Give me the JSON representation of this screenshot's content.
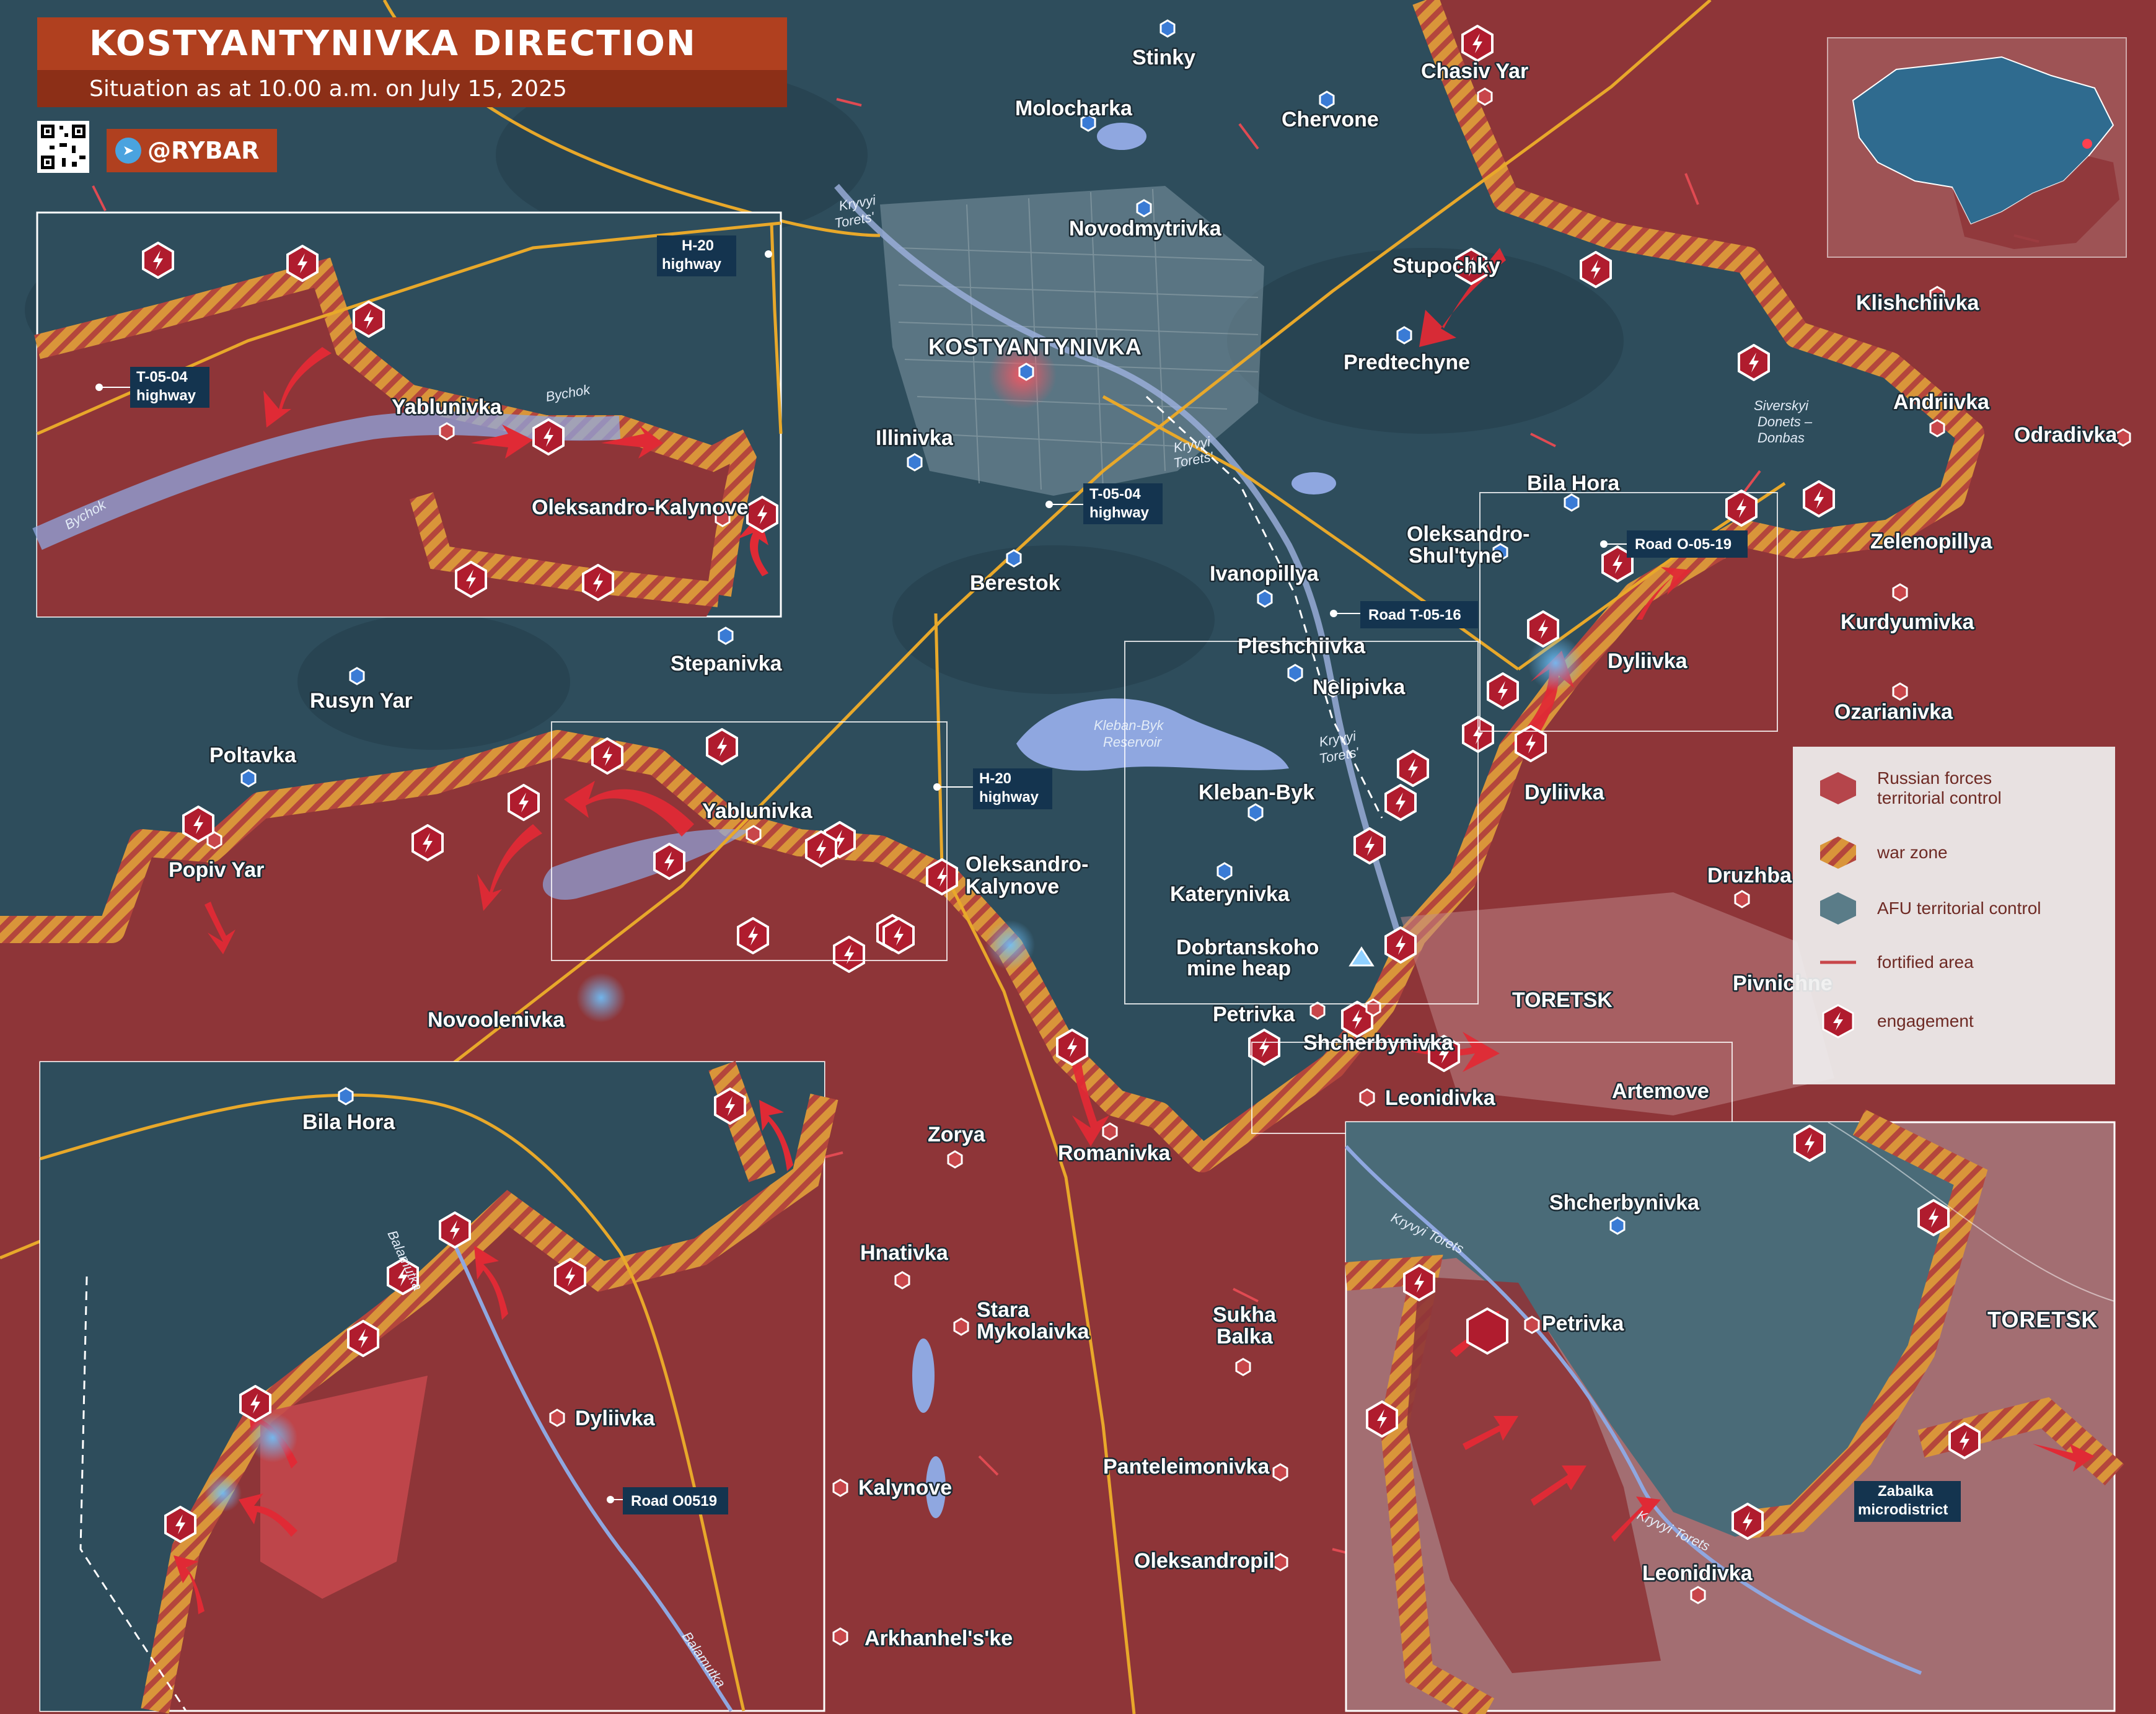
{
  "header": {
    "title": "KOSTYANTYNIVKA DIRECTION",
    "subtitle": "Situation as at 10.00 a.m. on July 15, 2025",
    "channel": "@RYBAR",
    "channel_icon": "telegram-icon",
    "qr_icon": "qr-code-icon"
  },
  "legend": {
    "items": [
      {
        "label": "Russian forces territorial control",
        "line1": "Russian forces",
        "line2": "territorial control",
        "icon": "russian-control-hexagon",
        "color": "#b5454b"
      },
      {
        "label": "war zone",
        "icon": "war-zone-hatch-hexagon",
        "color": "#d9953a"
      },
      {
        "label": "AFU territorial control",
        "icon": "afu-control-hexagon",
        "color": "#4a6b78"
      },
      {
        "label": "fortified area",
        "icon": "fortified-line",
        "color": "#c8464a"
      },
      {
        "label": "engagement",
        "icon": "engagement-lightning-icon",
        "color": "#b01c2e"
      }
    ]
  },
  "colors": {
    "russian": "#8e3538",
    "afu": "#2e4d5c",
    "warzone": "#d9953a",
    "road": "#e8a82a",
    "water": "#8fa7e0",
    "engagement": "#b01c2e"
  },
  "main_map": {
    "settlements": [
      {
        "name": "Stinky",
        "afu": true
      },
      {
        "name": "Chasiv Yar",
        "afu": false
      },
      {
        "name": "Molocharka",
        "afu": true
      },
      {
        "name": "Chervone",
        "afu": true
      },
      {
        "name": "Novodmytrivka",
        "afu": true
      },
      {
        "name": "Stupochky",
        "afu": false
      },
      {
        "name": "Klishchiivka",
        "afu": false
      },
      {
        "name": "KOSTYANTYNIVKA",
        "afu": true
      },
      {
        "name": "Predtechyne",
        "afu": true
      },
      {
        "name": "Andriivka",
        "afu": false
      },
      {
        "name": "Odradivka",
        "afu": false
      },
      {
        "name": "Illinivka",
        "afu": true
      },
      {
        "name": "Bila Hora",
        "afu": true
      },
      {
        "name": "Oleksandro-",
        "afu": true
      },
      {
        "name": "Shul'tyne",
        "afu": true
      },
      {
        "name": "Zelenopillya",
        "afu": false
      },
      {
        "name": "Berestok",
        "afu": true
      },
      {
        "name": "Ivanopillya",
        "afu": true
      },
      {
        "name": "Kurdyumivka",
        "afu": false
      },
      {
        "name": "Pleshchiivka",
        "afu": true
      },
      {
        "name": "Dyliivka",
        "afu": false
      },
      {
        "name": "Nelipivka",
        "afu": true
      },
      {
        "name": "Stepanivka",
        "afu": true
      },
      {
        "name": "Ozarianivka",
        "afu": false
      },
      {
        "name": "Rusyn Yar",
        "afu": true
      },
      {
        "name": "Poltavka",
        "afu": true
      },
      {
        "name": "Yablunivka",
        "afu": false
      },
      {
        "name": "Kleban-Byk",
        "afu": true
      },
      {
        "name": "Dyliivka",
        "afu": false
      },
      {
        "name": "Popiv Yar",
        "afu": false
      },
      {
        "name": "Oleksandro-",
        "afu": false
      },
      {
        "name": "Kalynove",
        "afu": false
      },
      {
        "name": "Druzhba",
        "afu": false
      },
      {
        "name": "Katerynivka",
        "afu": true
      },
      {
        "name": "Pivnichne",
        "afu": false
      },
      {
        "name": "Dobrtanskoho",
        "afu": false
      },
      {
        "name": "mine heap",
        "afu": false
      },
      {
        "name": "TORETSK",
        "afu": false
      },
      {
        "name": "Novoolenivka",
        "afu": false
      },
      {
        "name": "Petrivka",
        "afu": false
      },
      {
        "name": "Shcherbynivka",
        "afu": false
      },
      {
        "name": "Artemove",
        "afu": false
      },
      {
        "name": "Leonidivka",
        "afu": false
      },
      {
        "name": "Zorya",
        "afu": false
      },
      {
        "name": "Romanivka",
        "afu": false
      },
      {
        "name": "Hnativka",
        "afu": false
      },
      {
        "name": "Stara",
        "afu": false
      },
      {
        "name": "Mykolaivka",
        "afu": false
      },
      {
        "name": "Sukha",
        "afu": false
      },
      {
        "name": "Balka",
        "afu": false
      },
      {
        "name": "Kalynove",
        "afu": false
      },
      {
        "name": "Panteleimonivka",
        "afu": false
      },
      {
        "name": "Oleksandropil",
        "afu": false
      },
      {
        "name": "Arkhanhel's'ke",
        "afu": false
      }
    ],
    "water_labels": [
      "Kryvyi",
      "Torets'",
      "Kryvyi",
      "Torets'",
      "Kleban-Byk",
      "Reservoir",
      "Kryvyi",
      "Torets'",
      "Siverskyi",
      "Donets –",
      "Donbas"
    ],
    "road_labels": [
      {
        "prefix": "T-05-04",
        "suffix": "highway"
      },
      {
        "prefix": "H-20",
        "suffix": "highway"
      },
      {
        "prefix": "Road",
        "code": "T-05-16"
      },
      {
        "prefix": "Road",
        "code": "O-05-19"
      }
    ]
  },
  "inset_top_left": {
    "settlements": [
      "Yablunivka",
      "Oleksandro-Kalynove"
    ],
    "water": [
      "Bychok",
      "Bychok"
    ],
    "roads": [
      {
        "prefix": "T-05-04",
        "suffix": "highway"
      },
      {
        "prefix": "H-20",
        "suffix": "highway"
      }
    ]
  },
  "inset_bottom_left": {
    "settlements": [
      "Bila Hora",
      "Dyliivka"
    ],
    "water": [
      "Balamutka",
      "Balamutka"
    ],
    "roads": [
      {
        "prefix": "Road",
        "code": "O0519"
      }
    ]
  },
  "inset_bottom_right": {
    "settlements": [
      "Shcherbynivka",
      "Petrivka",
      "TORETSK",
      "Leonidivka"
    ],
    "water": [
      "Kryvyi Torets",
      "Kryvyi Torets"
    ],
    "roads": [
      {
        "prefix": "Zabalka",
        "suffix": "microdistrict"
      }
    ]
  }
}
